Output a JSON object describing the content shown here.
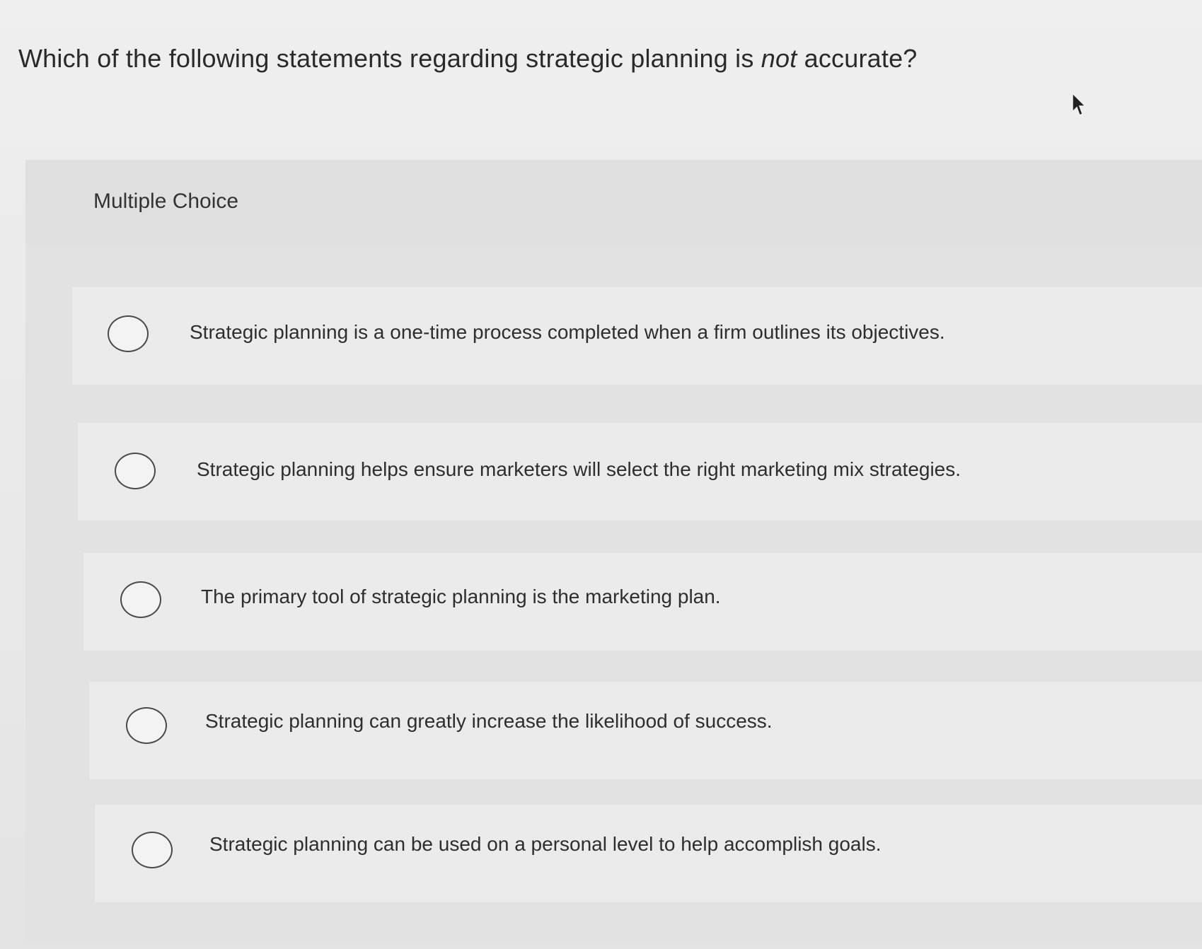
{
  "question": {
    "prefix": "Which of the following statements regarding strategic planning is ",
    "emphasis": "not",
    "suffix": " accurate?"
  },
  "panel": {
    "label": "Multiple Choice"
  },
  "options": [
    {
      "label": "Strategic planning is a one-time process completed when a firm outlines its objectives.",
      "selected": false
    },
    {
      "label": "Strategic planning helps ensure marketers will select the right marketing mix strategies.",
      "selected": false
    },
    {
      "label": "The primary tool of strategic planning is the marketing plan.",
      "selected": false
    },
    {
      "label": "Strategic planning can greatly increase the likelihood of success.",
      "selected": false
    },
    {
      "label": "Strategic planning can be used on a personal level to help accomplish goals.",
      "selected": false
    }
  ]
}
